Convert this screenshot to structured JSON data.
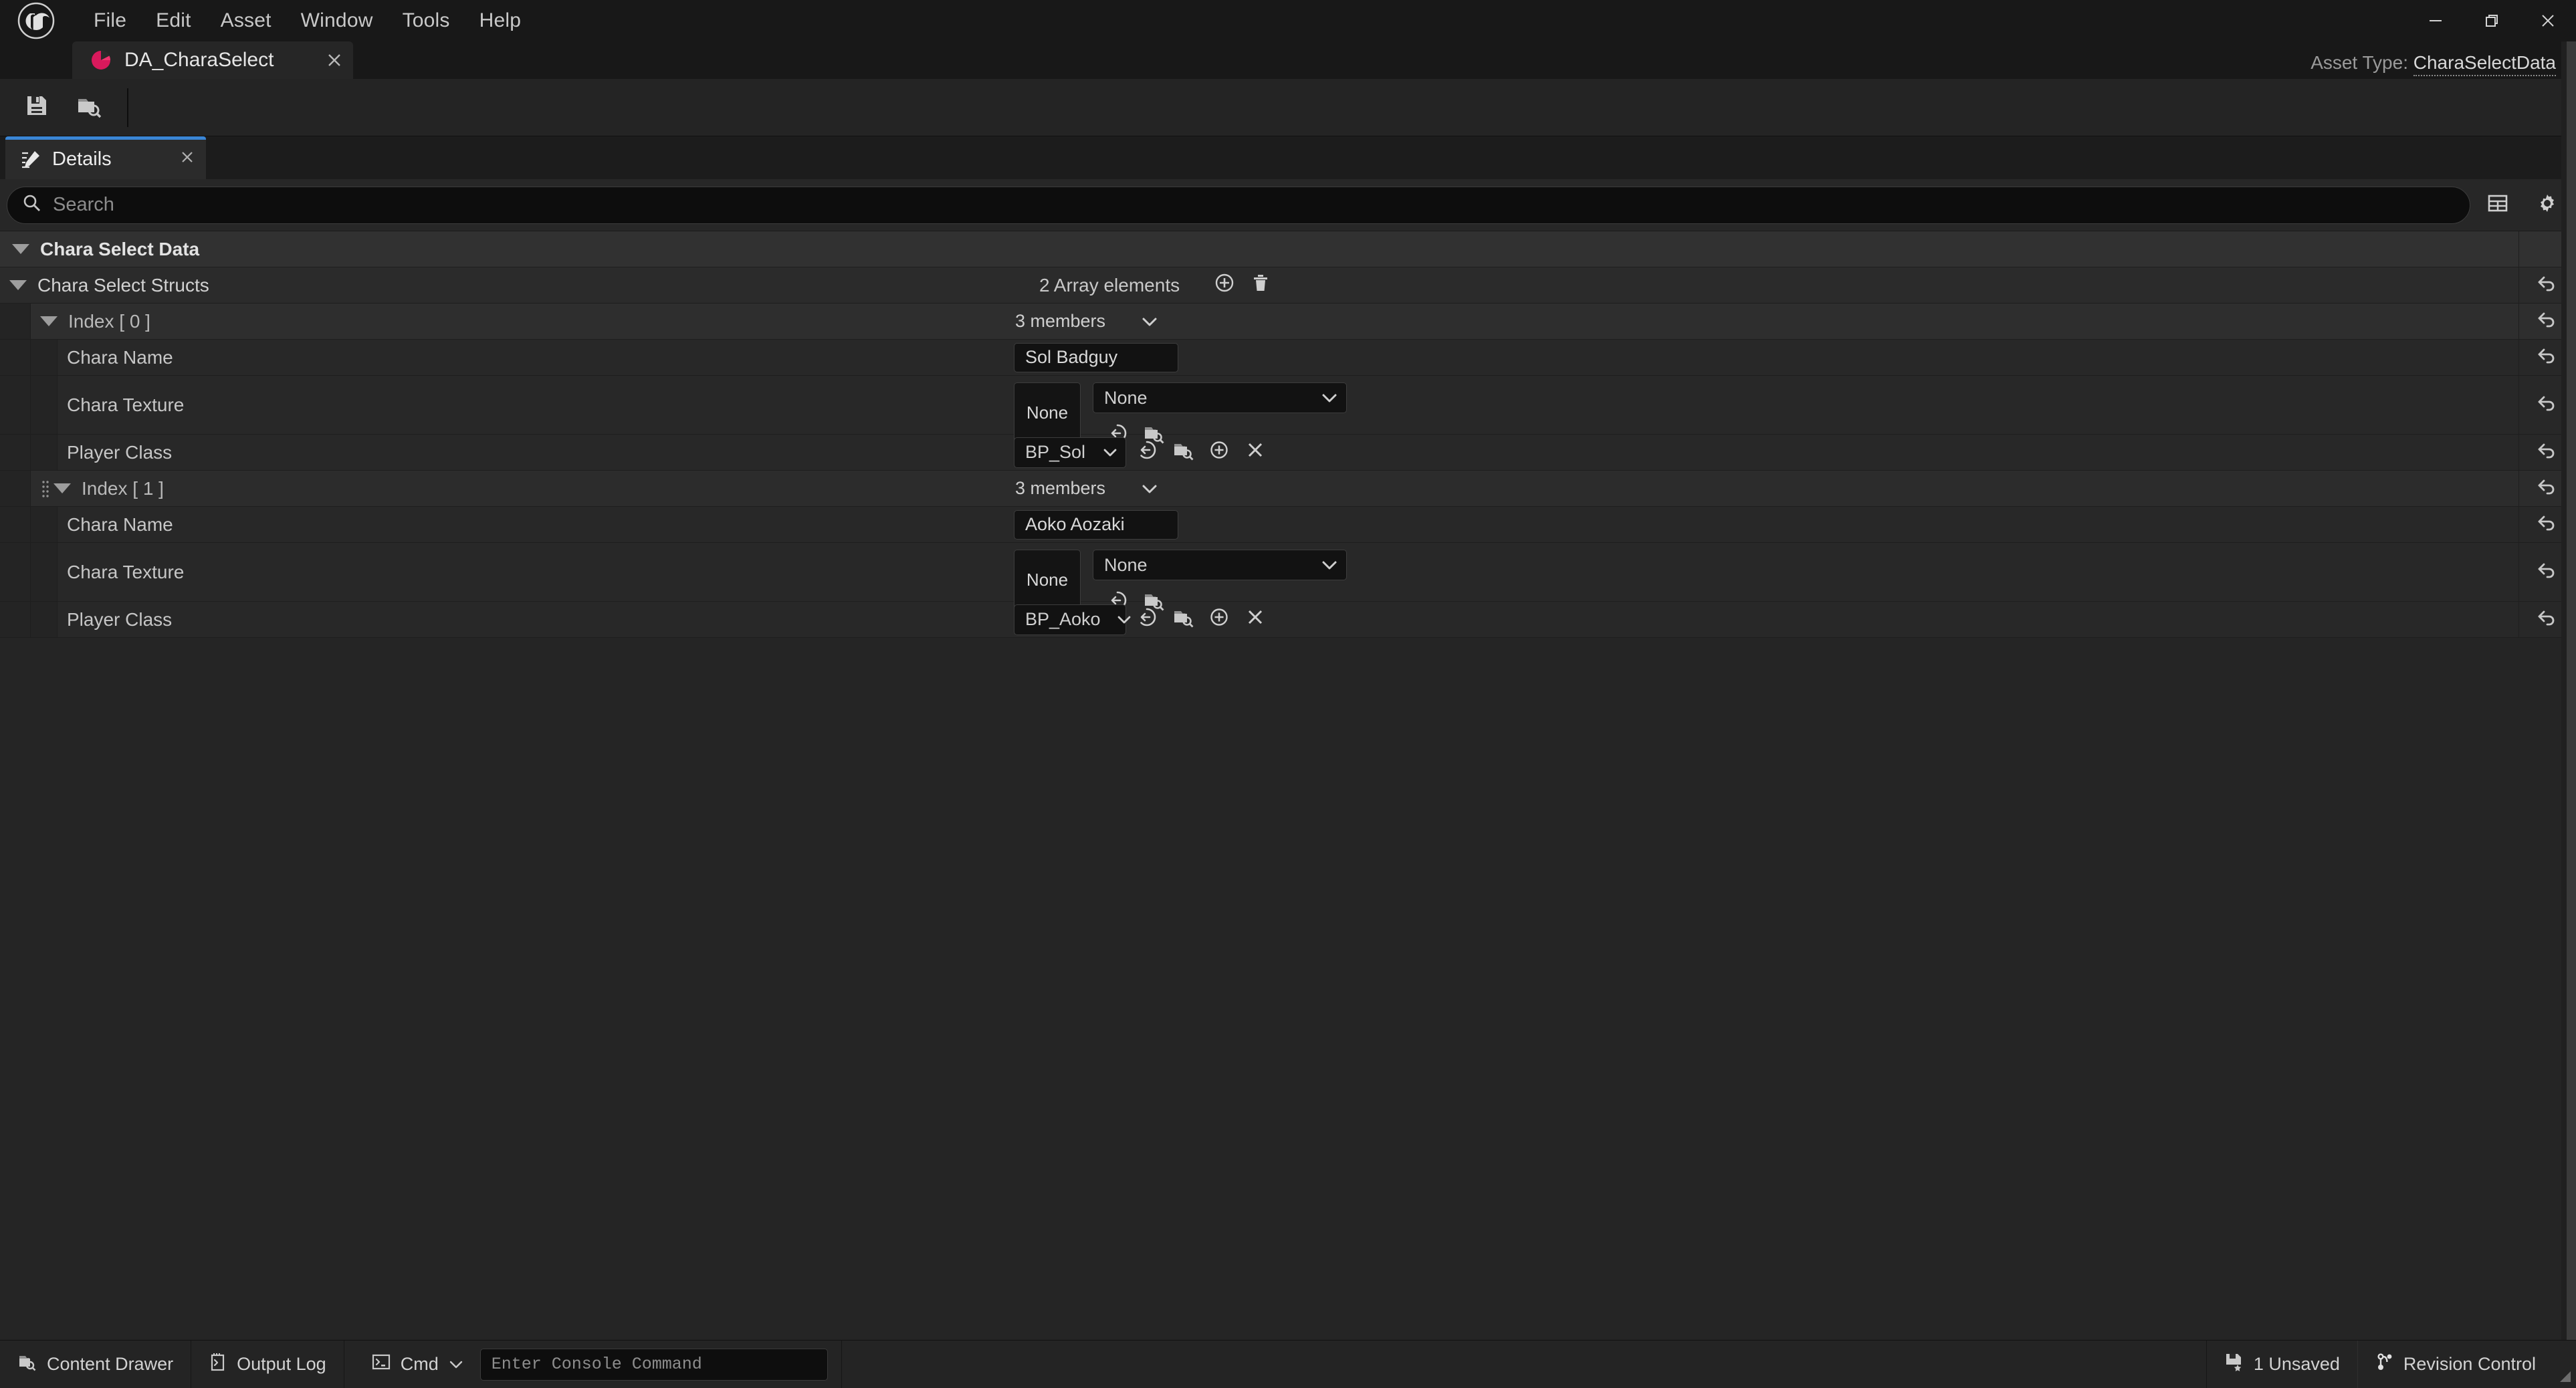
{
  "window": {
    "logo_icon": "unreal-engine-logo",
    "menus": [
      "File",
      "Edit",
      "Asset",
      "Window",
      "Tools",
      "Help"
    ],
    "controls": {
      "minimize": "minimize-icon",
      "maximize": "restore-icon",
      "close": "close-icon"
    }
  },
  "document_tab": {
    "label": "DA_CharaSelect",
    "icon": "data-asset-icon",
    "close_icon": "close-icon"
  },
  "asset_type": {
    "prefix": "Asset Type:",
    "value": "CharaSelectData"
  },
  "asset_toolbar": {
    "buttons": [
      {
        "name": "save-button",
        "icon": "save-icon"
      },
      {
        "name": "browse-button",
        "icon": "browse-folder-icon"
      }
    ]
  },
  "details_panel": {
    "tab_label": "Details",
    "tab_icon": "details-pencil-icon",
    "tab_close_icon": "close-icon",
    "accent_color": "#3a86d6"
  },
  "search": {
    "placeholder": "Search",
    "value": "",
    "icon": "search-icon",
    "buttons": [
      {
        "name": "column-view-button",
        "icon": "table-grid-icon"
      },
      {
        "name": "settings-button",
        "icon": "gear-icon"
      }
    ]
  },
  "tree": {
    "category": {
      "label": "Chara Select Data"
    },
    "array_property": {
      "label": "Chara Select Structs",
      "value_label": "2 Array elements",
      "add_icon": "plus-circle-icon",
      "delete_icon": "trash-icon"
    },
    "elements": [
      {
        "index_label": "Index [ 0 ]",
        "members_label": "3 members",
        "rows": [
          {
            "label": "Chara Name",
            "type": "text",
            "value": "Sol Badguy"
          },
          {
            "label": "Chara Texture",
            "type": "asset",
            "thumb_label": "None",
            "value": "None",
            "icons": [
              "use-selected-asset-icon",
              "browse-folder-icon"
            ]
          },
          {
            "label": "Player Class",
            "type": "class",
            "value": "BP_Sol",
            "icons": [
              "use-selected-asset-icon",
              "browse-folder-icon",
              "new-asset-icon",
              "clear-asset-icon"
            ]
          }
        ]
      },
      {
        "index_label": "Index [ 1 ]",
        "members_label": "3 members",
        "rows": [
          {
            "label": "Chara Name",
            "type": "text",
            "value": "Aoko Aozaki"
          },
          {
            "label": "Chara Texture",
            "type": "asset",
            "thumb_label": "None",
            "value": "None",
            "icons": [
              "use-selected-asset-icon",
              "browse-folder-icon"
            ]
          },
          {
            "label": "Player Class",
            "type": "class",
            "value": "BP_Aoko",
            "icons": [
              "use-selected-asset-icon",
              "browse-folder-icon",
              "new-asset-icon",
              "clear-asset-icon"
            ]
          }
        ]
      }
    ],
    "reset_icon": "reset-arrow-icon"
  },
  "statusbar": {
    "content_drawer": {
      "label": "Content Drawer",
      "icon": "content-drawer-icon"
    },
    "output_log": {
      "label": "Output Log",
      "icon": "output-log-icon"
    },
    "cmd": {
      "label": "Cmd",
      "icon": "console-prompt-icon",
      "chevron": "chevron-down-icon"
    },
    "console": {
      "placeholder": "Enter Console Command",
      "value": ""
    },
    "unsaved": {
      "label": "1 Unsaved",
      "icon": "save-star-icon"
    },
    "revision_control": {
      "label": "Revision Control",
      "icon": "source-branch-icon"
    }
  }
}
